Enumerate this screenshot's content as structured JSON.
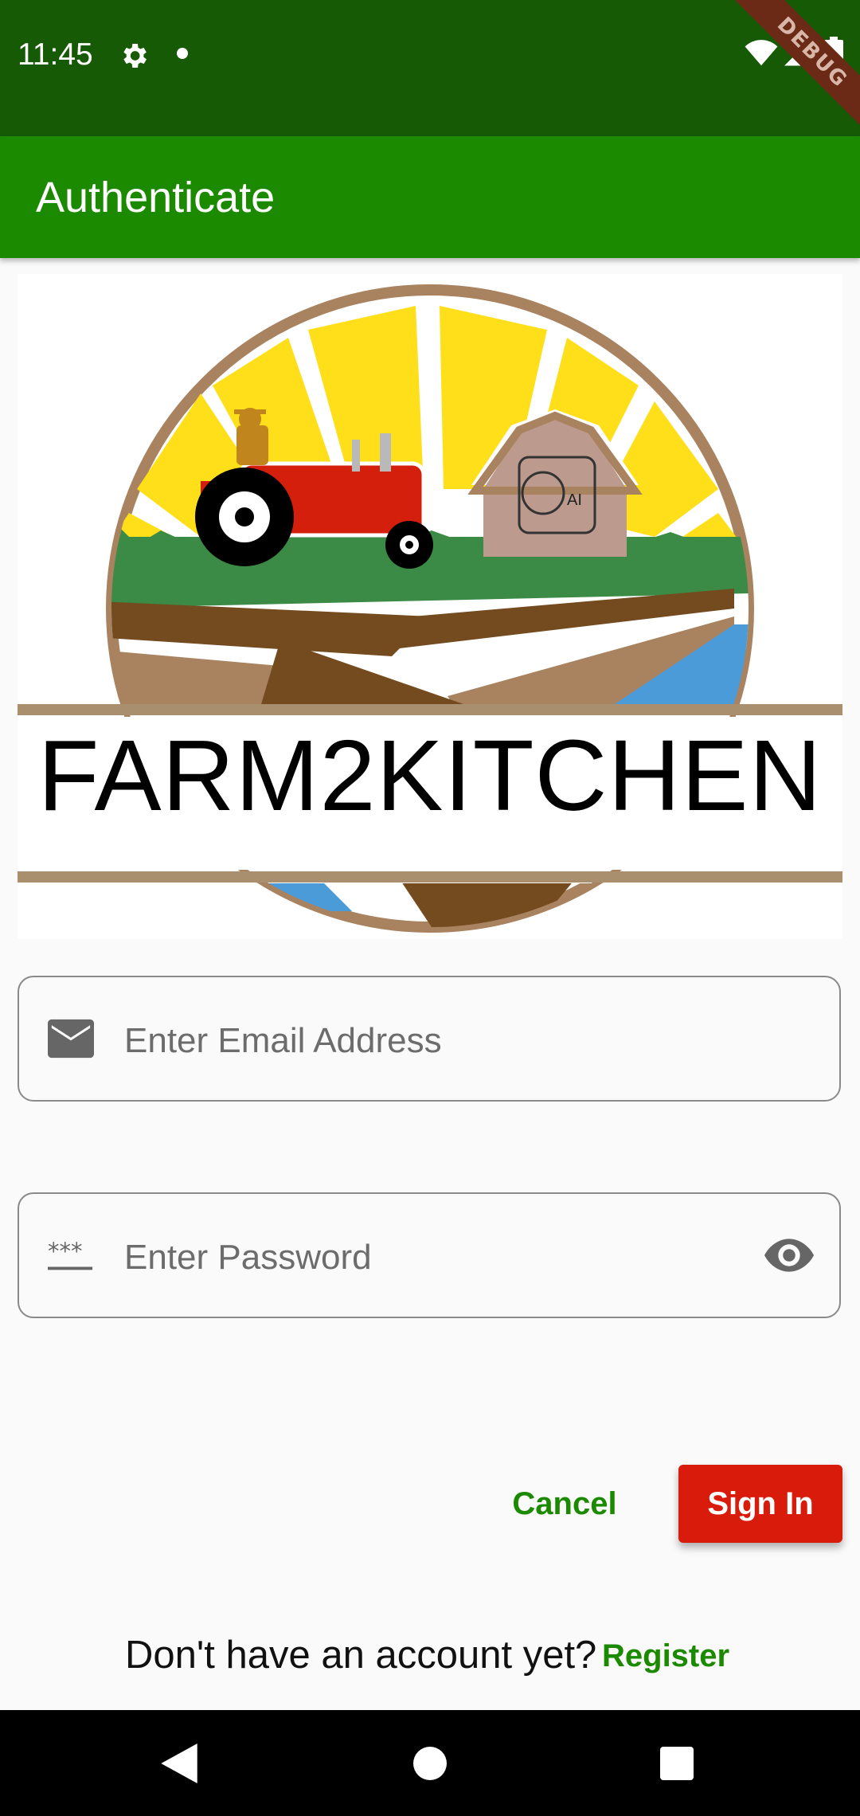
{
  "status_bar": {
    "time": "11:45",
    "icons": [
      "gear-icon",
      "notification-dot",
      "wifi-icon",
      "signal-icon",
      "battery-icon"
    ]
  },
  "debug_banner": "DEBUG",
  "app_bar": {
    "title": "Authenticate",
    "color": "#1b8a00"
  },
  "logo": {
    "text": "FARM2KITCHEN",
    "badge_text": "AI"
  },
  "form": {
    "email": {
      "placeholder": "Enter Email Address",
      "icon": "mail-icon",
      "value": ""
    },
    "password": {
      "placeholder": "Enter Password",
      "icon": "password-icon",
      "toggle_icon": "eye-icon",
      "value": ""
    }
  },
  "actions": {
    "cancel_label": "Cancel",
    "signin_label": "Sign In",
    "signin_color": "#d81b0b"
  },
  "register": {
    "prompt": "Don't have an account yet?",
    "link_label": "Register"
  },
  "nav_bar": {
    "icons": [
      "back-icon",
      "home-icon",
      "recent-apps-icon"
    ]
  }
}
